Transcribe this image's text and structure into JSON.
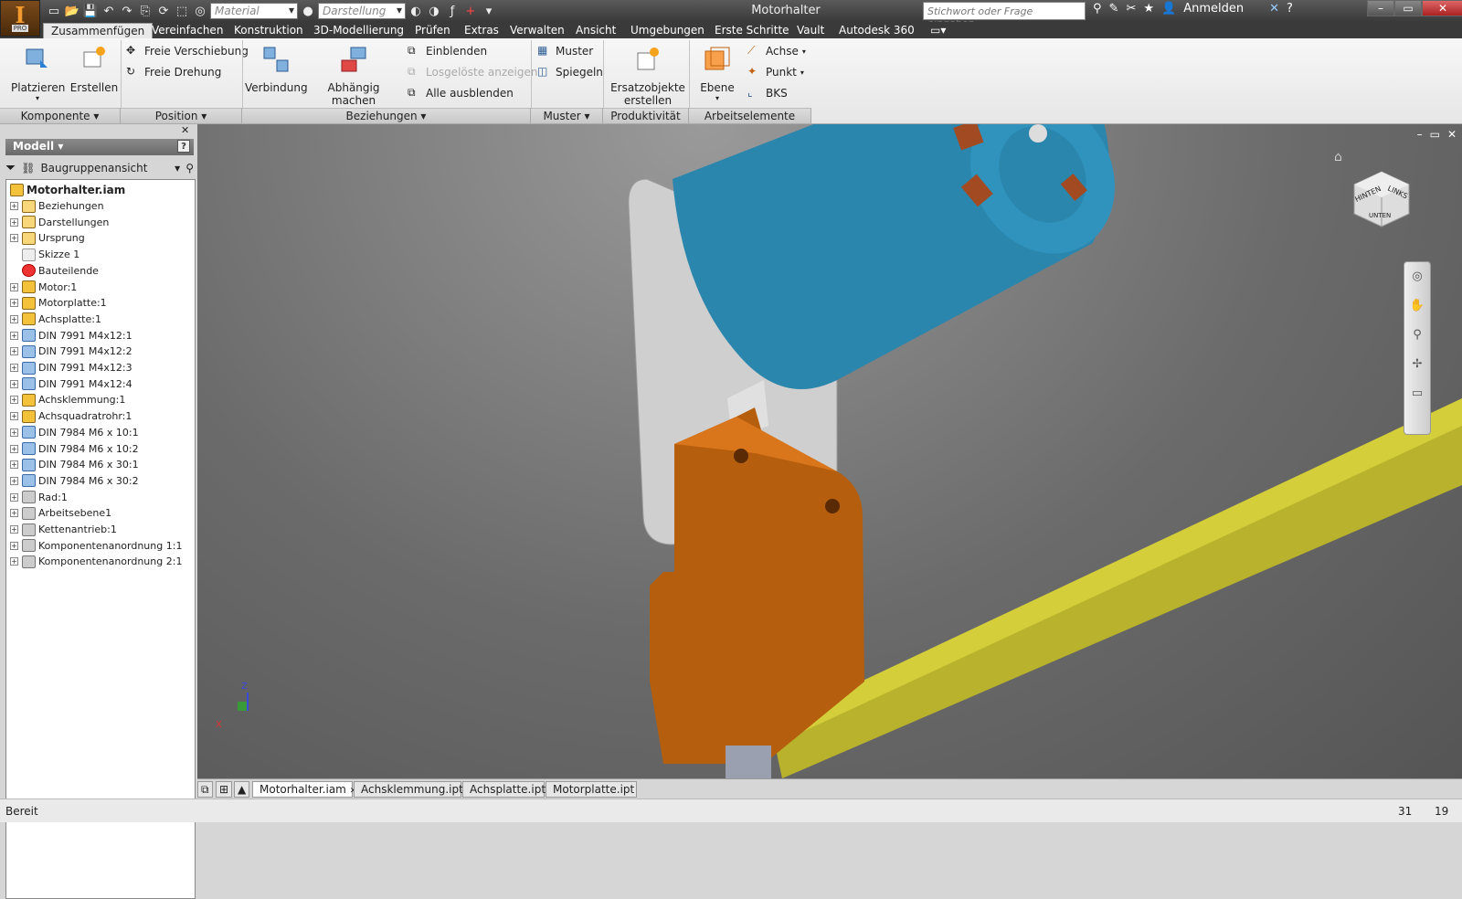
{
  "app": {
    "logo": "I",
    "edition": "PRO",
    "document_title": "Motorhalter",
    "search_placeholder": "Stichwort oder Frage eingeben",
    "sign_in": "Anmelden"
  },
  "quick_access": {
    "material_placeholder": "Material",
    "appearance_placeholder": "Darstellung"
  },
  "menu_tabs": [
    "Zusammenfügen",
    "Vereinfachen",
    "Konstruktion",
    "3D-Modellierung",
    "Prüfen",
    "Extras",
    "Verwalten",
    "Ansicht",
    "Umgebungen",
    "Erste Schritte",
    "Vault",
    "Autodesk 360"
  ],
  "ribbon": {
    "komponente": {
      "title": "Komponente",
      "place": "Platzieren",
      "create": "Erstellen"
    },
    "position": {
      "title": "Position",
      "free_move": "Freie Verschiebung",
      "free_rotate": "Freie Drehung"
    },
    "beziehungen": {
      "title": "Beziehungen",
      "joint": "Verbindung",
      "constrain": "Abhängig machen",
      "show": "Einblenden",
      "show_sick": "Losgelöste anzeigen",
      "hide_all": "Alle ausblenden"
    },
    "muster": {
      "title": "Muster",
      "pattern": "Muster",
      "mirror": "Spiegeln"
    },
    "produktivitaet": {
      "title": "Produktivität",
      "substitutes_l1": "Ersatzobjekte",
      "substitutes_l2": "erstellen"
    },
    "arbeitselemente": {
      "title": "Arbeitselemente",
      "plane": "Ebene",
      "axis": "Achse",
      "point": "Punkt",
      "ucs": "BKS"
    }
  },
  "browser": {
    "title": "Modell",
    "view": "Baugruppenansicht",
    "root": "Motorhalter.iam",
    "nodes": [
      {
        "label": "Beziehungen",
        "icon": "folder"
      },
      {
        "label": "Darstellungen",
        "icon": "representations"
      },
      {
        "label": "Ursprung",
        "icon": "folder"
      },
      {
        "label": "Skizze 1",
        "icon": "sketch"
      },
      {
        "label": "Bauteilende",
        "icon": "end-of-part"
      },
      {
        "label": "Motor:1",
        "icon": "assembly"
      },
      {
        "label": "Motorplatte:1",
        "icon": "part"
      },
      {
        "label": "Achsplatte:1",
        "icon": "part"
      },
      {
        "label": "DIN 7991 M4x12:1",
        "icon": "screw"
      },
      {
        "label": "DIN 7991 M4x12:2",
        "icon": "screw"
      },
      {
        "label": "DIN 7991 M4x12:3",
        "icon": "screw"
      },
      {
        "label": "DIN 7991 M4x12:4",
        "icon": "screw"
      },
      {
        "label": "Achsklemmung:1",
        "icon": "part"
      },
      {
        "label": "Achsquadratrohr:1",
        "icon": "part"
      },
      {
        "label": "DIN 7984 M6 x 10:1",
        "icon": "screw"
      },
      {
        "label": "DIN 7984 M6 x 10:2",
        "icon": "screw"
      },
      {
        "label": "DIN 7984 M6 x 30:1",
        "icon": "screw"
      },
      {
        "label": "DIN 7984 M6 x 30:2",
        "icon": "screw"
      },
      {
        "label": "Rad:1",
        "icon": "gray-part"
      },
      {
        "label": "Arbeitsebene1",
        "icon": "work-plane"
      },
      {
        "label": "Kettenantrieb:1",
        "icon": "chain"
      },
      {
        "label": "Komponentenanordnung 1:1",
        "icon": "pattern"
      },
      {
        "label": "Komponentenanordnung 2:1",
        "icon": "pattern"
      }
    ]
  },
  "viewcube": {
    "top": "HINTEN",
    "right": "LINKS",
    "bottom": "UNTEN"
  },
  "triad": {
    "x": "X",
    "z": "Z"
  },
  "document_tabs": [
    "Motorhalter.iam",
    "Achsklemmung.ipt",
    "Achsplatte.ipt",
    "Motorplatte.ipt"
  ],
  "status": {
    "text": "Bereit",
    "value1": "31",
    "value2": "19"
  },
  "colors": {
    "motor": "#2f8fb5",
    "plate": "#c9680f",
    "tube": "#c8c226",
    "bracket": "#c9c9c9",
    "brand": "#f29a2e"
  }
}
